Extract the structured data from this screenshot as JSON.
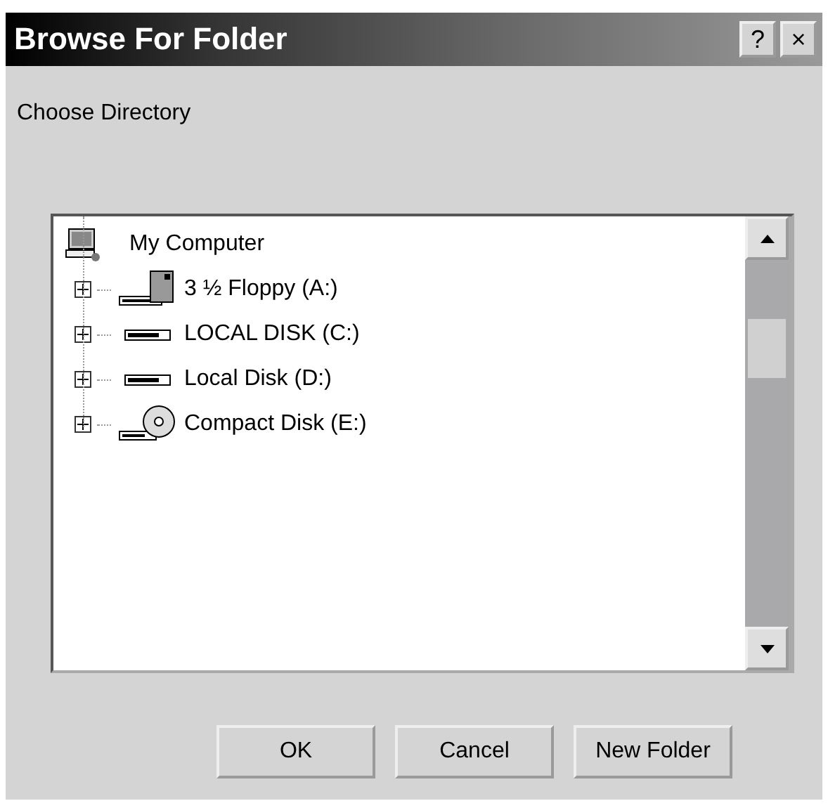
{
  "window": {
    "title": "Browse For Folder",
    "help_button": "?",
    "close_button": "×"
  },
  "prompt": "Choose Directory",
  "tree": {
    "root": {
      "label": "My Computer",
      "children": [
        {
          "label": "3 ½ Floppy (A:)",
          "kind": "floppy",
          "expanded": false
        },
        {
          "label": "LOCAL DISK (C:)",
          "kind": "disk",
          "expanded": false
        },
        {
          "label": "Local Disk (D:)",
          "kind": "disk",
          "expanded": false
        },
        {
          "label": "Compact Disk (E:)",
          "kind": "cd",
          "expanded": false
        }
      ]
    }
  },
  "buttons": [
    "OK",
    "Cancel",
    "New Folder"
  ]
}
